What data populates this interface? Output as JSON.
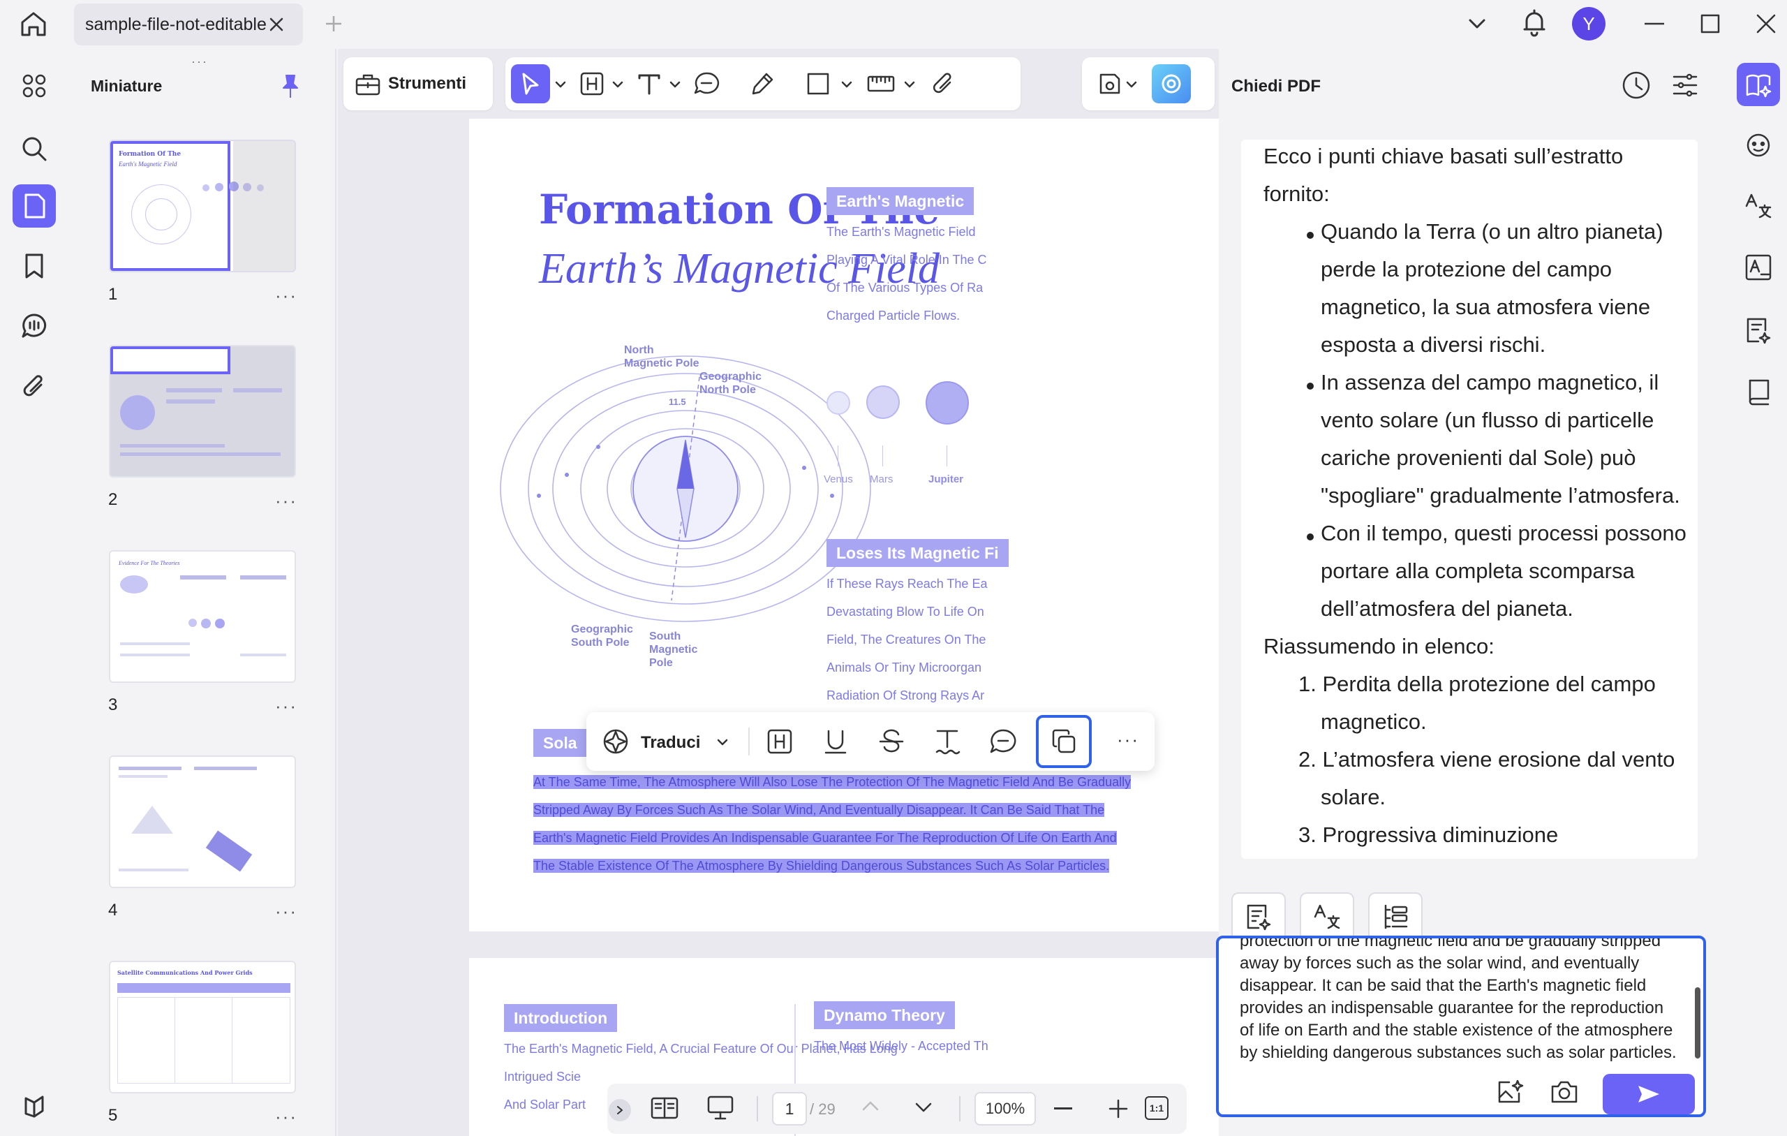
{
  "window": {
    "tab_title": "sample-file-not-editable",
    "avatar_letter": "Y"
  },
  "thumbnails": {
    "title": "Miniature",
    "pages": [
      {
        "number": "1"
      },
      {
        "number": "2"
      },
      {
        "number": "3"
      },
      {
        "number": "4"
      },
      {
        "number": "5"
      }
    ],
    "more_glyph": "···"
  },
  "toolbar": {
    "tools_label": "Strumenti"
  },
  "document": {
    "title_line1": "Formation Of The",
    "title_line2": "Earth’s Magnetic Field",
    "figure": {
      "north_magnetic_pole": [
        "North",
        "Magnetic Pole"
      ],
      "geographic_north_pole": [
        "Geographic",
        "North Pole"
      ],
      "geographic_south_pole": [
        "Geographic",
        "South Pole"
      ],
      "south_magnetic_pole": [
        "South",
        "Magnetic",
        "Pole"
      ],
      "angle": "11.5"
    },
    "section_earths_magnetic": {
      "heading": "Earth's Magnetic",
      "lines": [
        "The Earth's Magnetic Field",
        "Playing A Vital Role In The C",
        "Of The Various Types Of Ra",
        "Charged Particle Flows."
      ]
    },
    "planets": [
      "Venus",
      "Mars",
      "Jupiter"
    ],
    "section_loses": {
      "heading": "Loses Its Magnetic Fi",
      "lines": [
        "If These Rays Reach The Ea",
        "Devastating Blow To Life On",
        "Field, The Creatures On The",
        "Animals Or Tiny Microorgan",
        "Radiation Of Strong Rays Ar"
      ]
    },
    "solar_tag": "Sola",
    "selected_lines": [
      "At The Same Time, The Atmosphere Will Also Lose The Protection Of The Magnetic Field And Be Gradually",
      "Stripped Away By Forces Such As The Solar Wind, And Eventually Disappear. It Can Be Said That The",
      "Earth's Magnetic Field Provides An Indispensable Guarantee For The Reproduction Of Life On Earth And",
      "The Stable Existence Of The Atmosphere By Shielding Dangerous Substances Such As Solar Particles."
    ],
    "page2": {
      "introduction": "Introduction",
      "intro_lines": [
        "The Earth's Magnetic Field, A Crucial Feature Of Our Planet, Has Long",
        "Intrigued Scie",
        "And Solar Part"
      ],
      "dynamo": "Dynamo Theory",
      "dynamo_line": "The Most Widely - Accepted Th"
    }
  },
  "selection_toolbar": {
    "translate_label": "Traduci",
    "more": "···"
  },
  "page_nav": {
    "current_page": "1",
    "total_pages": "/ 29",
    "zoom": "100%",
    "fit": "1:1"
  },
  "chat": {
    "title": "Chiedi PDF",
    "lines": [
      "Ecco i punti chiave basati sull’estratto",
      "fornito:",
      "Quando la Terra (o un altro pianeta)",
      "perde la protezione del campo",
      "magnetico, la sua atmosfera viene",
      "esposta a diversi rischi.",
      "In assenza del campo magnetico, il",
      "vento solare (un flusso di particelle",
      "cariche provenienti dal Sole) può",
      "\"spogliare\" gradualmente l’atmosfera.",
      "Con il tempo, questi processi possono",
      "portare alla completa scomparsa",
      "dell’atmosfera del pianeta.",
      "Riassumendo in elenco:",
      "1. Perdita della protezione del campo",
      "magnetico.",
      "2. L’atmosfera viene erosione dal vento",
      "solare.",
      "3. Progressiva diminuzione"
    ],
    "input_lines": [
      "protection of the magnetic field and be gradually stripped",
      "away by forces such as the solar wind, and eventually",
      "disappear. It can be said that the Earth's magnetic field",
      "provides an indispensable guarantee for the reproduction",
      "of life on Earth and the stable existence of the atmosphere",
      "by shielding dangerous substances such as solar particles."
    ]
  },
  "colors": {
    "accent": "#6b63f5",
    "doc_purple": "#5855e8",
    "highlight": "#9b98f3",
    "input_border": "#2f62e8"
  }
}
